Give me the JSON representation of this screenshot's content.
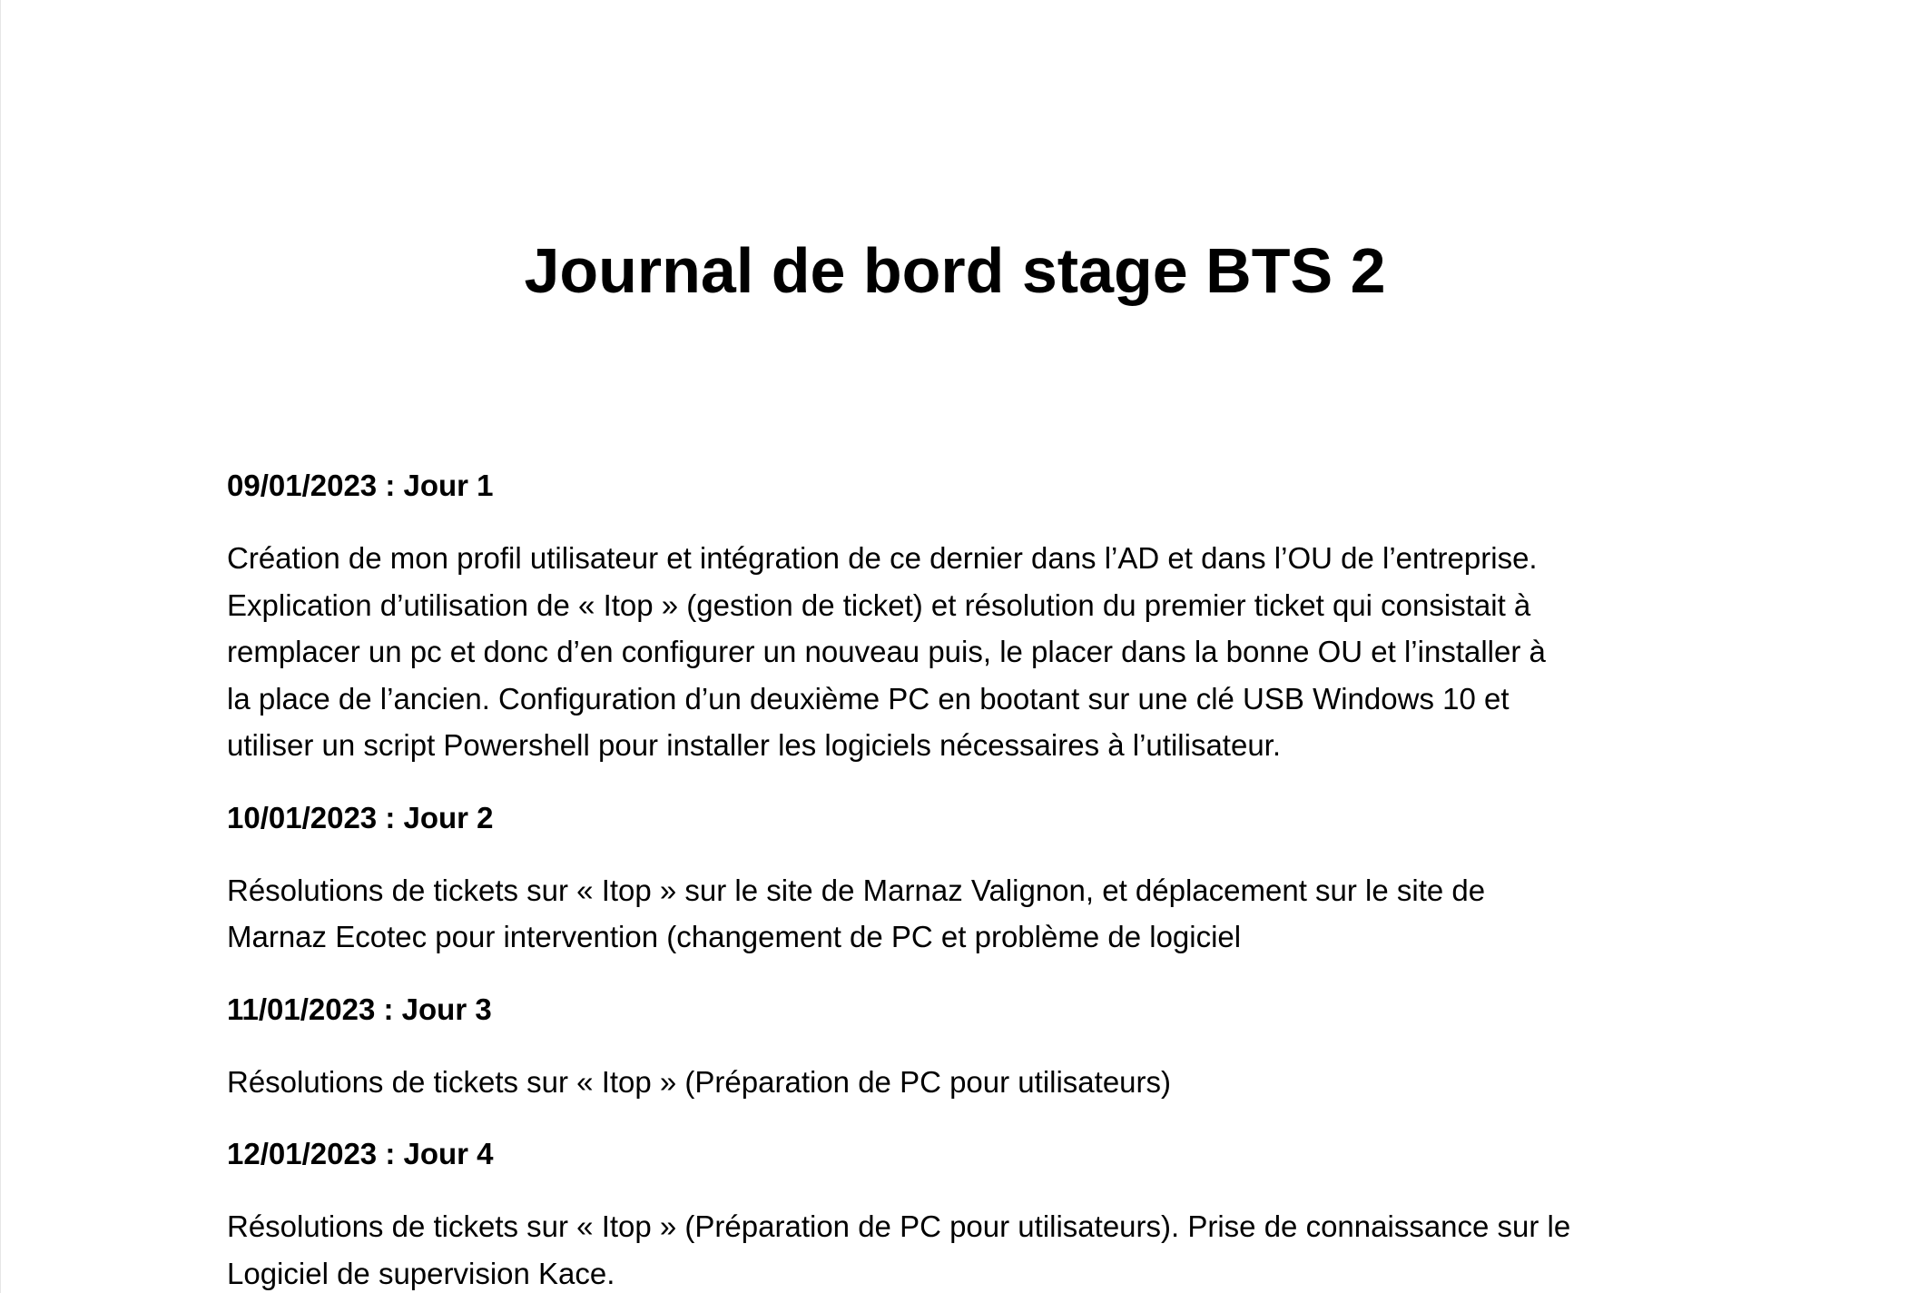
{
  "document": {
    "title": "Journal de bord stage BTS 2",
    "entries": [
      {
        "date": "09/01/2023 : Jour 1",
        "lines": [
          "Création de mon profil utilisateur et intégration de ce dernier dans l’AD et dans l’OU de l’entreprise.",
          "Explication d’utilisation de « Itop » (gestion de ticket) et résolution du premier ticket qui consistait à",
          "remplacer un pc et donc d’en configurer un nouveau puis, le placer dans la bonne OU et l’installer à",
          "la place de l’ancien. Configuration d’un deuxième PC en bootant sur une clé USB Windows 10 et",
          "utiliser un script Powershell pour installer les logiciels nécessaires à l’utilisateur."
        ]
      },
      {
        "date": "10/01/2023 : Jour 2",
        "lines": [
          "Résolutions de tickets sur « Itop » sur le site de Marnaz Valignon, et déplacement sur le site de",
          "Marnaz Ecotec pour intervention (changement de PC et problème de logiciel"
        ]
      },
      {
        "date": "11/01/2023 : Jour 3",
        "lines": [
          "Résolutions de tickets sur « Itop » (Préparation de PC pour utilisateurs)"
        ]
      },
      {
        "date": "12/01/2023 : Jour 4",
        "lines": [
          "Résolutions de tickets sur « Itop » (Préparation de PC pour utilisateurs). Prise de connaissance sur le",
          "Logiciel de supervision Kace."
        ]
      }
    ]
  }
}
